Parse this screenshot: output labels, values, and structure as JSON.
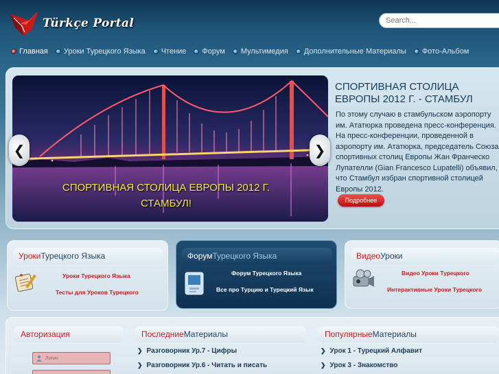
{
  "header": {
    "logo_text": "Türkçe Portal",
    "search_placeholder": "Search..."
  },
  "nav": {
    "items": [
      {
        "label": "Главная",
        "active": true
      },
      {
        "label": "Уроки Турецкого Языка"
      },
      {
        "label": "Чтение"
      },
      {
        "label": "Форум"
      },
      {
        "label": "Мультимедия"
      },
      {
        "label": "Дополнительные Материалы"
      },
      {
        "label": "Фото-Альбом"
      }
    ]
  },
  "hero": {
    "caption_line1": "СПОРТИВНАЯ СТОЛИЦА ЕВРОПЫ 2012 Г.",
    "caption_line2": "СТАМБУЛ!",
    "title": "СПОРТИВНАЯ СТОЛИЦА ЕВРОПЫ 2012 Г. - СТАМБУЛ",
    "text": "По этому случаю в стамбульском аэропорту им. Ататюрка проведена пресс-конференция. На пресс-конференции, проведенной в аэропорту им. Ататюрка, председатель Союза спортивных столиц Европы Жан Франческо Лупателли (Gian Francesco Lupatelli) объявил, что Стамбул избран спортивной столицей Европы 2012.",
    "more_label": "Подробнее",
    "prev_glyph": "❮",
    "next_glyph": "❯"
  },
  "boxes": {
    "lessons": {
      "title_accent": "Уроки",
      "title_rest": " Турецкого Языка",
      "links": [
        "Уроки Турецкого Языка",
        "Тесты для Уроков Турецкого"
      ]
    },
    "forum": {
      "title_accent": "Форум",
      "title_rest": " Турецкого Языка",
      "links": [
        "Форум Турецкого Языка",
        "Все про Турцию и Турецкий Язык"
      ]
    },
    "video": {
      "title_accent": "Видео",
      "title_rest": " Уроки",
      "links": [
        "Видео Уроки Турецкого",
        "Интерактивные Уроки Турецкого"
      ]
    }
  },
  "auth": {
    "title": "Авторизация",
    "login_placeholder": "Логин"
  },
  "latest": {
    "title_accent": "Последние",
    "title_rest": " Материалы",
    "items": [
      "Разговорник Ур.7 - Цифры",
      "Разговорник Ур.6 - Читать и писать"
    ]
  },
  "popular": {
    "title_accent": "Популярные",
    "title_rest": " Материалы",
    "items": [
      "Урок 1 - Турецкий Алфавит",
      "Урок 3 - Знакомство"
    ]
  },
  "colors": {
    "accent_red": "#c41d1d",
    "navy": "#1f3f5d",
    "bg_dark": "#0f3450"
  }
}
